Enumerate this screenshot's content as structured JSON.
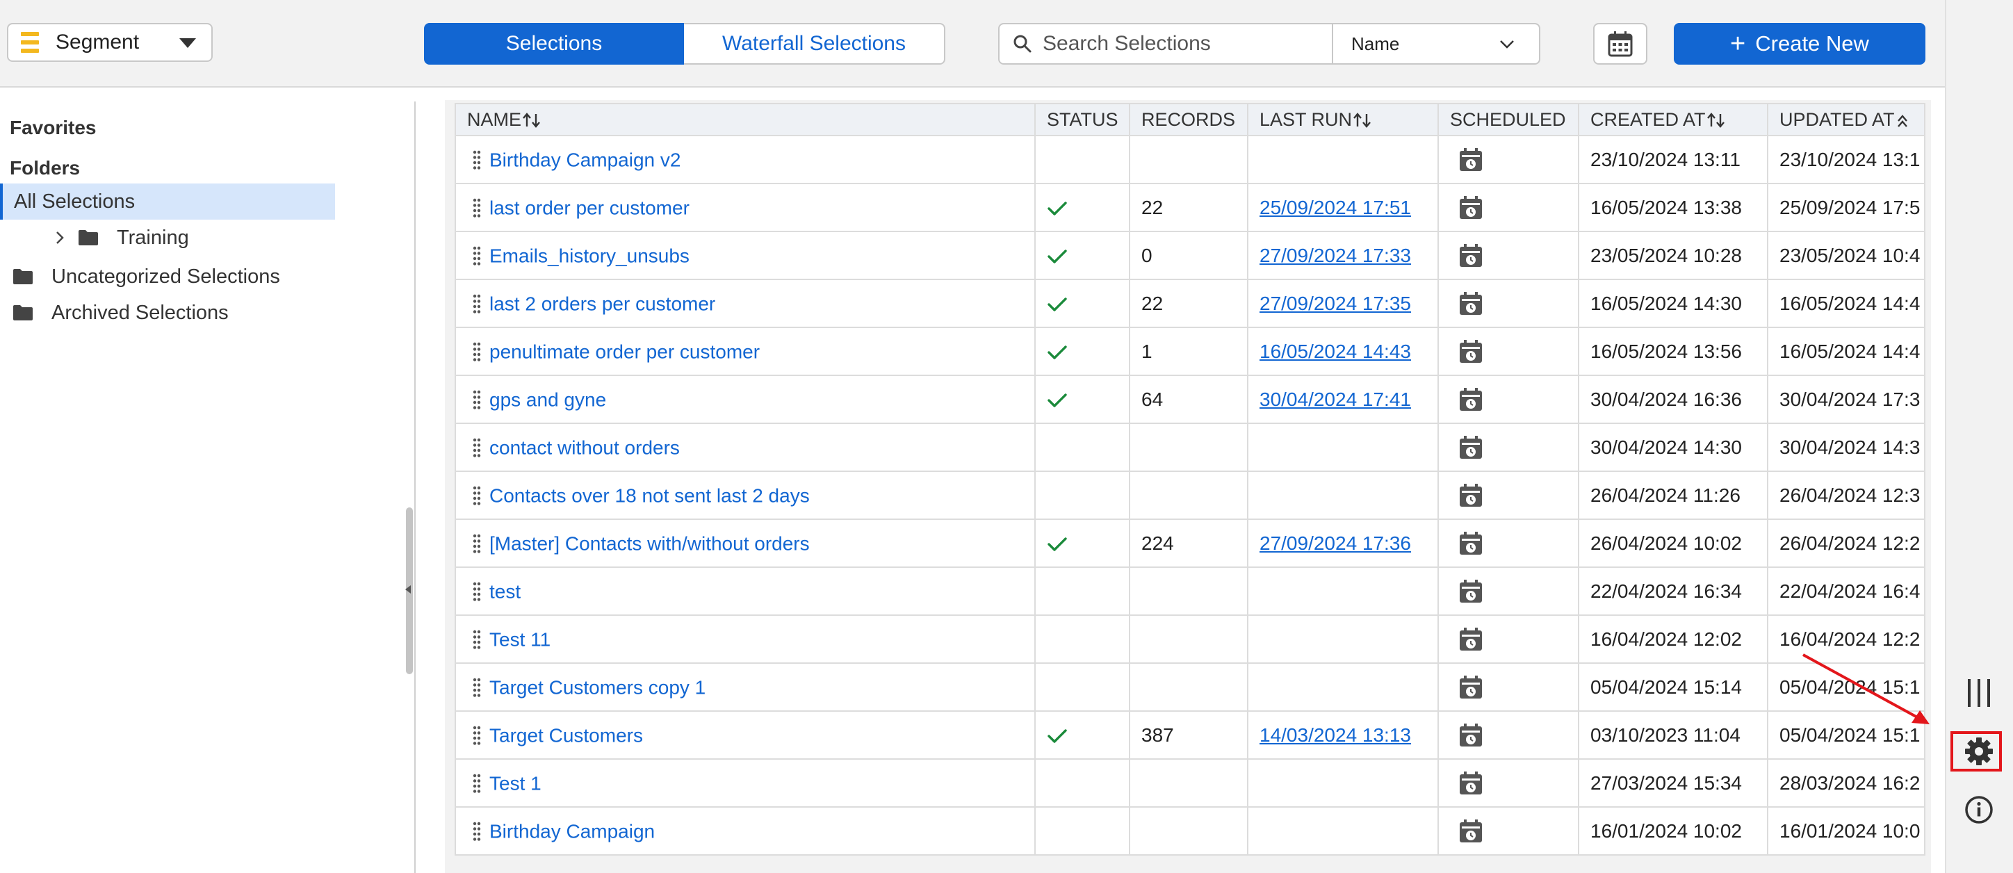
{
  "topbar": {
    "segment_label": "Segment",
    "tabs": [
      {
        "label": "Selections",
        "active": true
      },
      {
        "label": "Waterfall Selections",
        "active": false
      }
    ],
    "search_placeholder": "Search Selections",
    "search_field_value": "Name",
    "create_label": "Create New"
  },
  "sidebar": {
    "favorites_heading": "Favorites",
    "folders_heading": "Folders",
    "all_selections": "All Selections",
    "training": "Training",
    "uncategorized": "Uncategorized Selections",
    "archived": "Archived Selections"
  },
  "table": {
    "headers": {
      "name": "NAME",
      "status": "STATUS",
      "records": "RECORDS",
      "last_run": "LAST RUN",
      "scheduled": "SCHEDULED",
      "created_at": "CREATED AT",
      "updated_at": "UPDATED AT"
    },
    "rows": [
      {
        "name": "Birthday Campaign v2",
        "status_ok": false,
        "records": "",
        "last_run": "",
        "created_at": "23/10/2024 13:11",
        "updated_at": "23/10/2024 13:1"
      },
      {
        "name": "last order per customer",
        "status_ok": true,
        "records": "22",
        "last_run": "25/09/2024 17:51",
        "created_at": "16/05/2024 13:38",
        "updated_at": "25/09/2024 17:5"
      },
      {
        "name": "Emails_history_unsubs",
        "status_ok": true,
        "records": "0",
        "last_run": "27/09/2024 17:33",
        "created_at": "23/05/2024 10:28",
        "updated_at": "23/05/2024 10:4"
      },
      {
        "name": "last 2 orders per customer",
        "status_ok": true,
        "records": "22",
        "last_run": "27/09/2024 17:35",
        "created_at": "16/05/2024 14:30",
        "updated_at": "16/05/2024 14:4"
      },
      {
        "name": "penultimate order per customer",
        "status_ok": true,
        "records": "1",
        "last_run": "16/05/2024 14:43",
        "created_at": "16/05/2024 13:56",
        "updated_at": "16/05/2024 14:4"
      },
      {
        "name": "gps and gyne",
        "status_ok": true,
        "records": "64",
        "last_run": "30/04/2024 17:41",
        "created_at": "30/04/2024 16:36",
        "updated_at": "30/04/2024 17:3"
      },
      {
        "name": "contact without orders",
        "status_ok": false,
        "records": "",
        "last_run": "",
        "created_at": "30/04/2024 14:30",
        "updated_at": "30/04/2024 14:3"
      },
      {
        "name": "Contacts over 18 not sent last 2 days",
        "status_ok": false,
        "records": "",
        "last_run": "",
        "created_at": "26/04/2024 11:26",
        "updated_at": "26/04/2024 12:3"
      },
      {
        "name": "[Master] Contacts with/without orders",
        "status_ok": true,
        "records": "224",
        "last_run": "27/09/2024 17:36",
        "created_at": "26/04/2024 10:02",
        "updated_at": "26/04/2024 12:2"
      },
      {
        "name": "test",
        "status_ok": false,
        "records": "",
        "last_run": "",
        "created_at": "22/04/2024 16:34",
        "updated_at": "22/04/2024 16:4"
      },
      {
        "name": "Test 11",
        "status_ok": false,
        "records": "",
        "last_run": "",
        "created_at": "16/04/2024 12:02",
        "updated_at": "16/04/2024 12:2"
      },
      {
        "name": "Target Customers copy 1",
        "status_ok": false,
        "records": "",
        "last_run": "",
        "created_at": "05/04/2024 15:14",
        "updated_at": "05/04/2024 15:1"
      },
      {
        "name": "Target Customers",
        "status_ok": true,
        "records": "387",
        "last_run": "14/03/2024 13:13",
        "created_at": "03/10/2023 11:04",
        "updated_at": "05/04/2024 15:1"
      },
      {
        "name": "Test 1",
        "status_ok": false,
        "records": "",
        "last_run": "",
        "created_at": "27/03/2024 15:34",
        "updated_at": "28/03/2024 16:2"
      },
      {
        "name": "Birthday Campaign",
        "status_ok": false,
        "records": "",
        "last_run": "",
        "created_at": "16/01/2024 10:02",
        "updated_at": "16/01/2024 10:0"
      }
    ]
  },
  "colors": {
    "primary": "#1266d2",
    "check": "#1a8a3a",
    "highlight": "#e3161b",
    "segment_icon": "#f3b81f"
  },
  "icons": [
    "segment-icon",
    "chevron-down-icon",
    "search-icon",
    "calendar-icon",
    "plus-icon",
    "folder-icon",
    "chevron-right-icon",
    "sort-icon",
    "drag-handle-icon",
    "check-icon",
    "schedule-icon",
    "columns-icon",
    "gear-icon",
    "info-icon"
  ]
}
